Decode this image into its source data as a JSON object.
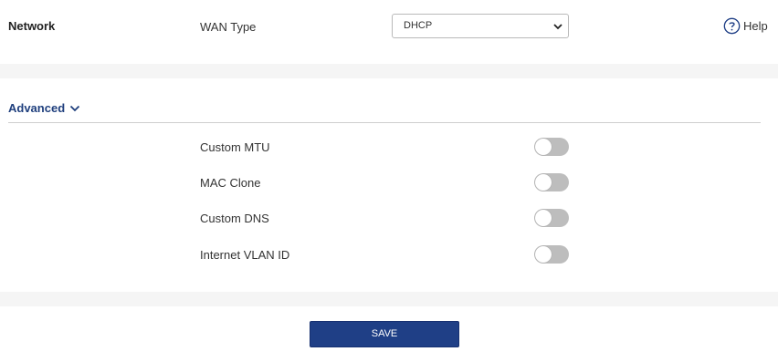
{
  "network": {
    "title": "Network",
    "wan_type_label": "WAN Type",
    "wan_type_value": "DHCP",
    "help_label": "Help"
  },
  "advanced": {
    "label": "Advanced",
    "options": [
      {
        "label": "Custom MTU",
        "enabled": false
      },
      {
        "label": "MAC Clone",
        "enabled": false
      },
      {
        "label": "Custom DNS",
        "enabled": false
      },
      {
        "label": "Internet VLAN ID",
        "enabled": false
      }
    ]
  },
  "actions": {
    "save_label": "SAVE"
  },
  "colors": {
    "accent": "#1f3f86",
    "link": "#1f3f7d",
    "toggle_off": "#bdbdbd"
  }
}
